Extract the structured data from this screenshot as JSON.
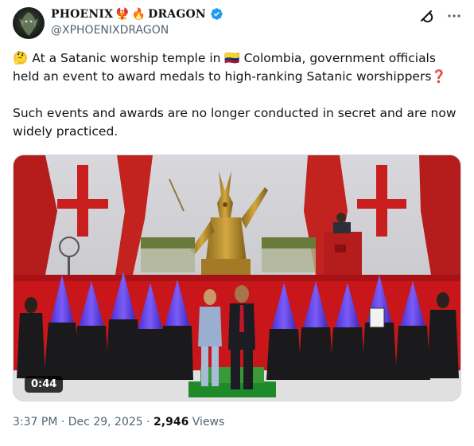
{
  "author": {
    "display_name_part1": "PHOENIX",
    "display_name_part2": "DRAGON",
    "emoji_bird": "🐦‍🔥",
    "emoji_fire": "🔥",
    "handle": "@XPHOENIXDRAGON",
    "verified": true,
    "verified_color": "#1d9bf0"
  },
  "icons": {
    "grok": "grok-icon",
    "more": "more-icon"
  },
  "tweet": {
    "emoji_thinking": "🤔",
    "line1_before_flag": "At a Satanic worship temple in",
    "flag": "🇨🇴",
    "line1_after_flag": "Colombia, government officials held an event to award medals to high-ranking Satanic worshippers",
    "emoji_question": "❓",
    "paragraph2": "Such events and awards are no longer conducted in secret and are now widely practiced."
  },
  "media": {
    "type": "video",
    "duration": "0:44"
  },
  "meta": {
    "time": "3:37 PM",
    "separator": "·",
    "date": "Dec 29, 2025",
    "views_count": "2,946",
    "views_label": "Views"
  }
}
